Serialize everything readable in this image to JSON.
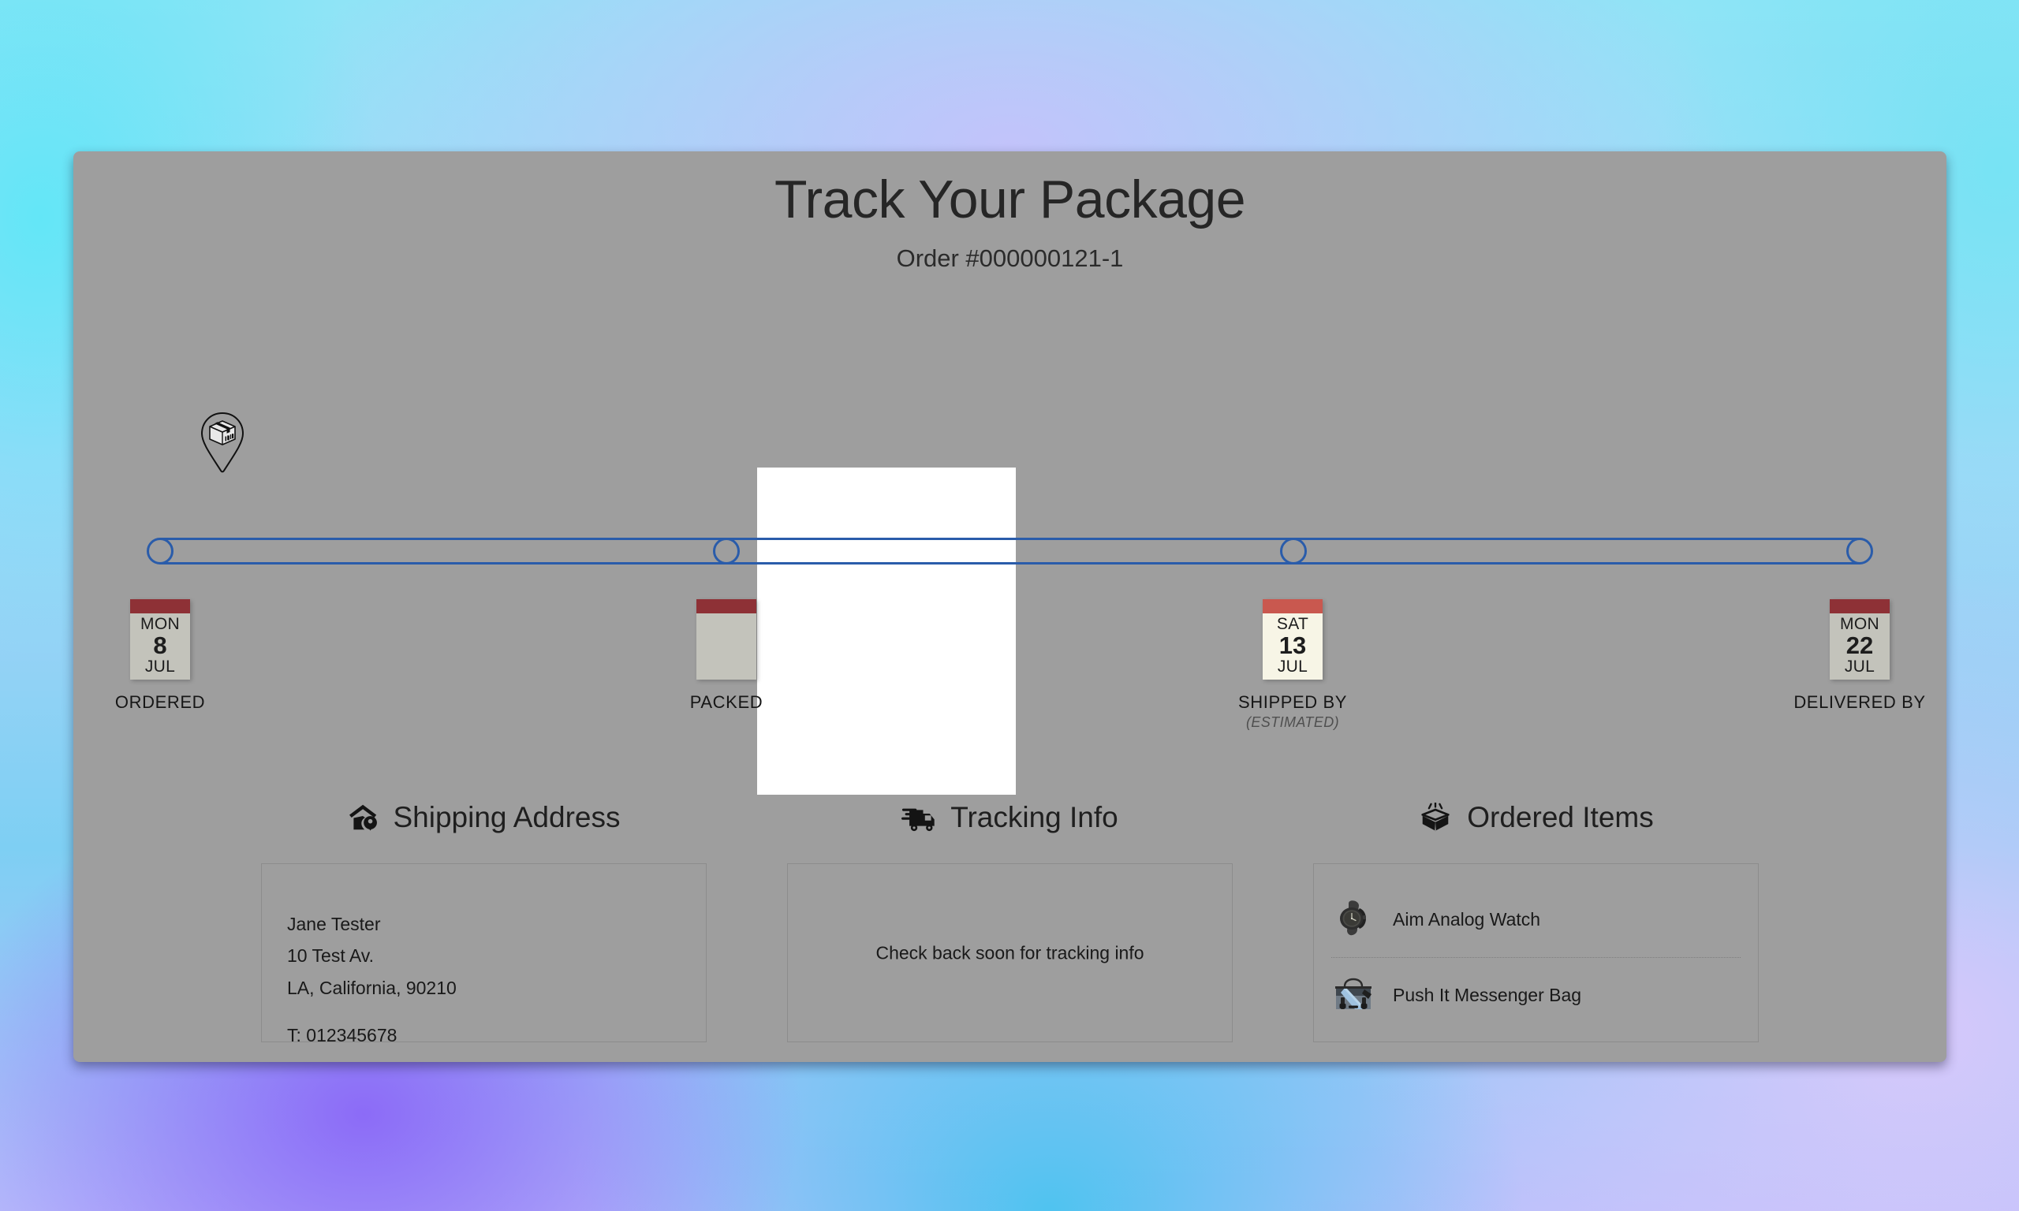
{
  "header": {
    "title": "Track Your Package",
    "order_number": "Order #000000121-1"
  },
  "colors": {
    "card_background": "#9e9e9e",
    "track_blue": "#2a5caa",
    "calendar_header_inactive": "#8e3136",
    "calendar_header_active": "#c9584f",
    "calendar_body_inactive": "#c3c3bb",
    "calendar_body_active": "#f7f5e6",
    "spotlight": "#ffffff"
  },
  "timeline": {
    "pin_icon": "package-pin-icon",
    "steps": [
      {
        "label": "ORDERED",
        "sublabel": "",
        "dow": "MON",
        "day": "8",
        "month": "JUL",
        "has_date": true,
        "active": false,
        "position_pct": 0
      },
      {
        "label": "PACKED",
        "sublabel": "",
        "dow": "",
        "day": "",
        "month": "",
        "has_date": false,
        "active": false,
        "position_pct": 33.33
      },
      {
        "label": "SHIPPED BY",
        "sublabel": "(ESTIMATED)",
        "dow": "SAT",
        "day": "13",
        "month": "JUL",
        "has_date": true,
        "active": true,
        "position_pct": 66.66
      },
      {
        "label": "DELIVERED BY",
        "sublabel": "",
        "dow": "MON",
        "day": "22",
        "month": "JUL",
        "has_date": true,
        "active": false,
        "position_pct": 100
      }
    ]
  },
  "panels": {
    "shipping_address": {
      "title": "Shipping Address",
      "icon": "house-location-icon",
      "name": "Jane Tester",
      "street": "10 Test Av.",
      "city_state_zip": "LA, California, 90210",
      "phone": "T: 012345678"
    },
    "tracking_info": {
      "title": "Tracking Info",
      "icon": "delivery-truck-icon",
      "empty_message": "Check back soon for tracking info"
    },
    "ordered_items": {
      "title": "Ordered Items",
      "icon": "open-box-icon",
      "items": [
        {
          "name": "Aim Analog Watch",
          "thumb": "watch-thumbnail"
        },
        {
          "name": "Push It Messenger Bag",
          "thumb": "messenger-bag-thumbnail"
        }
      ]
    }
  }
}
